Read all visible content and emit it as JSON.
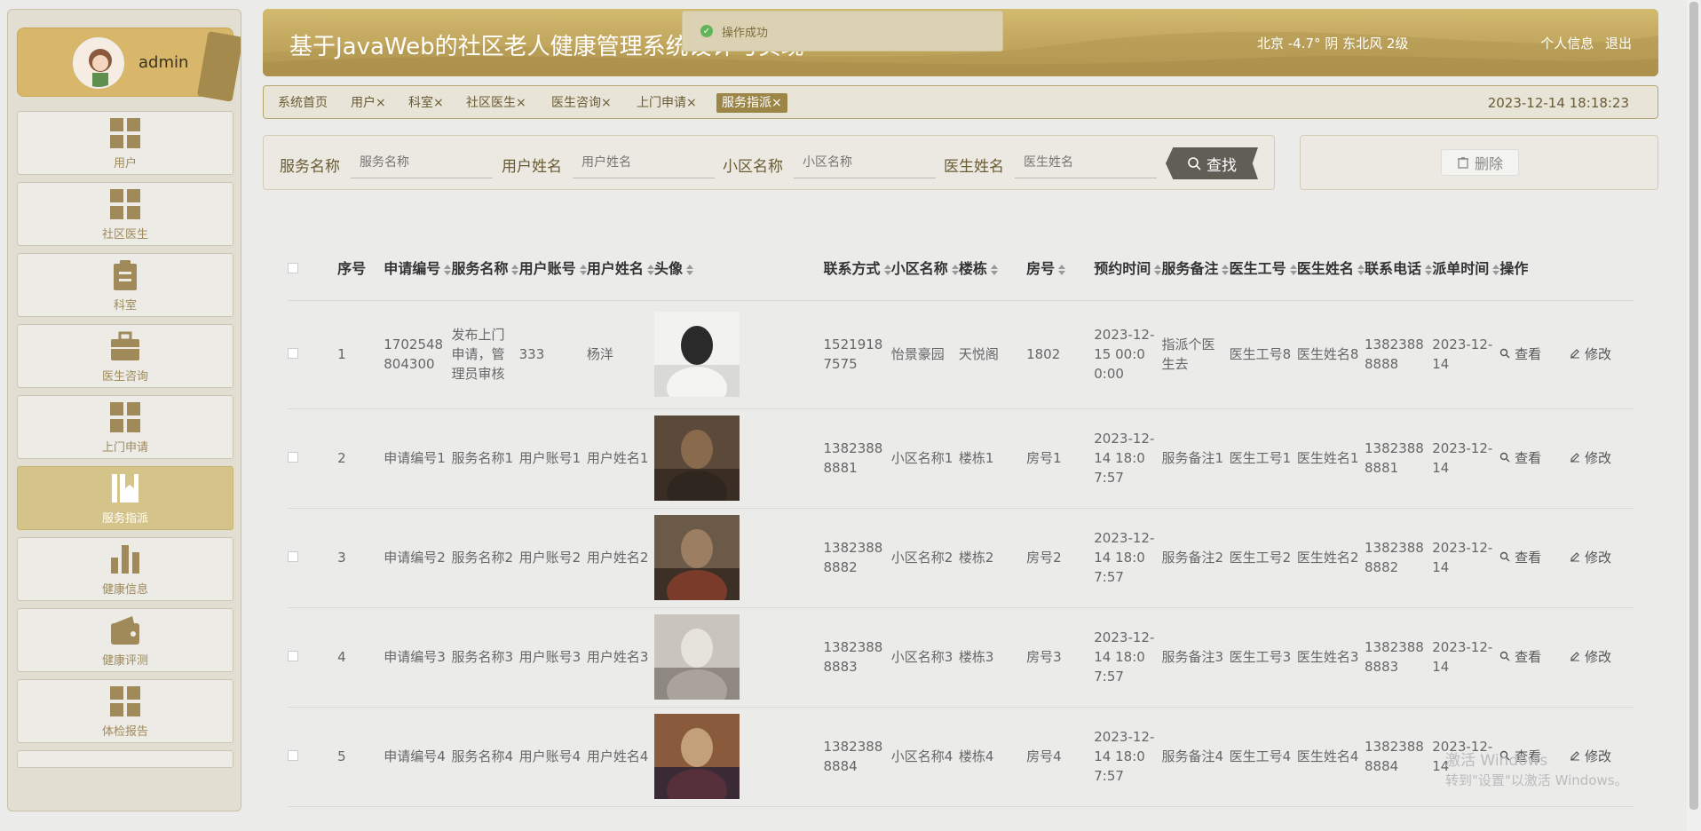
{
  "user": {
    "name": "admin"
  },
  "menu": [
    {
      "label": "用户",
      "icon": "grid-icon"
    },
    {
      "label": "社区医生",
      "icon": "grid-icon"
    },
    {
      "label": "科室",
      "icon": "clipboard-icon"
    },
    {
      "label": "医生咨询",
      "icon": "briefcase-icon"
    },
    {
      "label": "上门申请",
      "icon": "grid-icon"
    },
    {
      "label": "服务指派",
      "icon": "bookmark-icon",
      "active": true
    },
    {
      "label": "健康信息",
      "icon": "bar-chart-icon"
    },
    {
      "label": "健康评测",
      "icon": "wallet-icon"
    },
    {
      "label": "体检报告",
      "icon": "grid-icon"
    }
  ],
  "header": {
    "title": "基于JavaWeb的社区老人健康管理系统设计与实现",
    "weather": "北京  -4.7°  阴  东北风  2级",
    "profile_link": "个人信息",
    "logout_link": "退出",
    "toast": "操作成功"
  },
  "tabs": {
    "items": [
      "系统首页",
      "用户",
      "科室",
      "社区医生",
      "医生咨询",
      "上门申请",
      "服务指派"
    ],
    "close_mark": "×",
    "datetime": "2023-12-14 18:18:23"
  },
  "search": {
    "fields": [
      {
        "label": "服务名称",
        "placeholder": "服务名称"
      },
      {
        "label": "用户姓名",
        "placeholder": "用户姓名"
      },
      {
        "label": "小区名称",
        "placeholder": "小区名称"
      },
      {
        "label": "医生姓名",
        "placeholder": "医生姓名"
      }
    ],
    "button": "查找",
    "delete_button": "删除"
  },
  "table": {
    "columns": [
      "序号",
      "申请编号",
      "服务名称",
      "用户账号",
      "用户姓名",
      "头像",
      "联系方式",
      "小区名称",
      "楼栋",
      "房号",
      "预约时间",
      "服务备注",
      "医生工号",
      "医生姓名",
      "联系电话",
      "派单时间",
      "操作"
    ],
    "view_label": "查看",
    "edit_label": "修改",
    "rows": [
      [
        "1",
        "1702548804300",
        "发布上门申请，管理员审核",
        "333",
        "杨洋",
        "",
        "15219187575",
        "怡景豪园",
        "天悦阁",
        "1802",
        "2023-12-15 00:00:00",
        "指派个医生去",
        "医生工号8",
        "医生姓名8",
        "13823888888",
        "2023-12-14"
      ],
      [
        "2",
        "申请编号1",
        "服务名称1",
        "用户账号1",
        "用户姓名1",
        "",
        "13823888881",
        "小区名称1",
        "楼栋1",
        "房号1",
        "2023-12-14 18:07:57",
        "服务备注1",
        "医生工号1",
        "医生姓名1",
        "13823888881",
        "2023-12-14"
      ],
      [
        "3",
        "申请编号2",
        "服务名称2",
        "用户账号2",
        "用户姓名2",
        "",
        "13823888882",
        "小区名称2",
        "楼栋2",
        "房号2",
        "2023-12-14 18:07:57",
        "服务备注2",
        "医生工号2",
        "医生姓名2",
        "13823888882",
        "2023-12-14"
      ],
      [
        "4",
        "申请编号3",
        "服务名称3",
        "用户账号3",
        "用户姓名3",
        "",
        "13823888883",
        "小区名称3",
        "楼栋3",
        "房号3",
        "2023-12-14 18:07:57",
        "服务备注3",
        "医生工号3",
        "医生姓名3",
        "13823888883",
        "2023-12-14"
      ],
      [
        "5",
        "申请编号4",
        "服务名称4",
        "用户账号4",
        "用户姓名4",
        "",
        "13823888884",
        "小区名称4",
        "楼栋4",
        "房号4",
        "2023-12-14 18:07:57",
        "服务备注4",
        "医生工号4",
        "医生姓名4",
        "13823888884",
        "2023-12-14"
      ]
    ]
  },
  "watermark": {
    "line1": "激活 Windows",
    "line2": "转到\"设置\"以激活 Windows。"
  },
  "colors": {
    "accent": "#c2a75e",
    "active_tab": "#9b8547",
    "menu_active": "#d5c48a"
  }
}
